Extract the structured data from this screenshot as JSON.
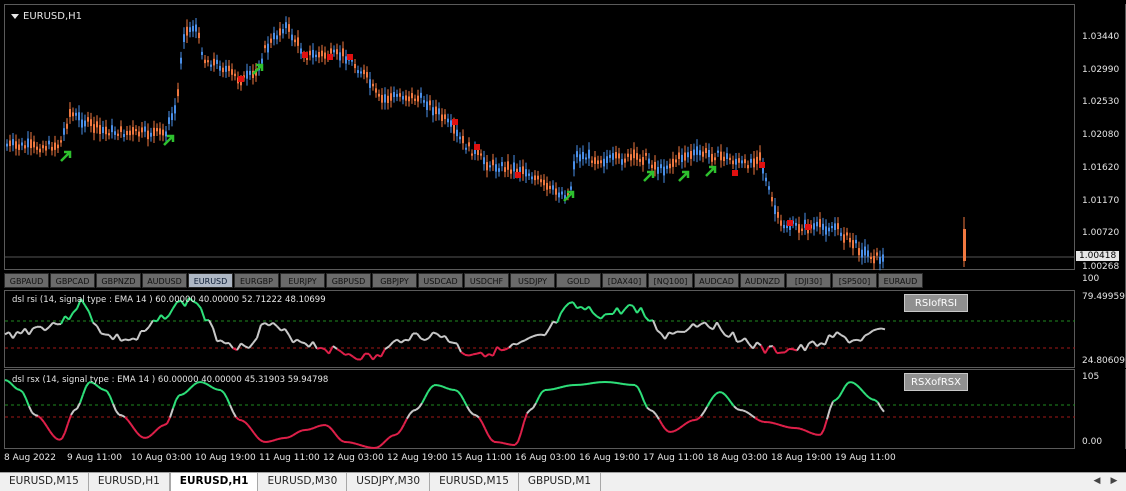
{
  "window": {
    "title": "EURUSD,H1"
  },
  "price_axis": {
    "labels": [
      "1.03440",
      "1.02990",
      "1.02530",
      "1.02080",
      "1.01620",
      "1.01170",
      "1.00720",
      "1.00268"
    ],
    "current_price": "1.00418"
  },
  "symbol_buttons": [
    {
      "label": "GBPAUD"
    },
    {
      "label": "GBPCAD"
    },
    {
      "label": "GBPNZD"
    },
    {
      "label": "AUDUSD"
    },
    {
      "label": "EURUSD",
      "active": true
    },
    {
      "label": "EURGBP"
    },
    {
      "label": "EURJPY"
    },
    {
      "label": "GBPUSD"
    },
    {
      "label": "GBPJPY"
    },
    {
      "label": "USDCAD"
    },
    {
      "label": "USDCHF"
    },
    {
      "label": "USDJPY"
    },
    {
      "label": "GOLD"
    },
    {
      "label": "[DAX40]"
    },
    {
      "label": "[NQ100]"
    },
    {
      "label": "AUDCAD"
    },
    {
      "label": "AUDNZD"
    },
    {
      "label": "[DJI30]"
    },
    {
      "label": "[SP500]"
    },
    {
      "label": "EURAUD"
    }
  ],
  "indicator_rsi": {
    "label": "dsl rsi (14, signal type : EMA  14 ) 60.00000 40.00000 52.71222 48.10699",
    "button": "RSIofRSI",
    "axis": [
      "79.49959",
      "24.80609"
    ],
    "axis_top": "100"
  },
  "indicator_rsx": {
    "label": "dsl rsx (14, signal type : EMA  14 ) 60.00000 40.00000 45.31903 59.94798",
    "button": "RSXofRSX",
    "axis": [
      "105",
      "0.00"
    ]
  },
  "time_axis": [
    "8 Aug 2022",
    "9 Aug 11:00",
    "10 Aug 03:00",
    "10 Aug 19:00",
    "11 Aug 11:00",
    "12 Aug 03:00",
    "12 Aug 19:00",
    "15 Aug 11:00",
    "16 Aug 03:00",
    "16 Aug 19:00",
    "17 Aug 11:00",
    "18 Aug 03:00",
    "18 Aug 19:00",
    "19 Aug 11:00"
  ],
  "tabs": [
    {
      "label": "EURUSD,M15"
    },
    {
      "label": "EURUSD,H1"
    },
    {
      "label": "EURUSD,H1",
      "active": true
    },
    {
      "label": "EURUSD,M30"
    },
    {
      "label": "USDJPY,M30"
    },
    {
      "label": "EURUSD,M15"
    },
    {
      "label": "GBPUSD,M1"
    }
  ],
  "colors": {
    "bull_candle": "#4a8fe8",
    "bear_candle": "#f07840",
    "buy_arrow": "#2ec02e",
    "sell_arrow": "#e01010",
    "osc_up": "#2ee07a",
    "osc_down": "#e0204a",
    "osc_neutral": "#c8c8c8",
    "level_up": "#1f8a1f",
    "level_down": "#a01818"
  },
  "icons": {
    "dropdown": "triangle-down-icon",
    "tab_prev": "arrow-left-icon",
    "tab_next": "arrow-right-icon"
  }
}
